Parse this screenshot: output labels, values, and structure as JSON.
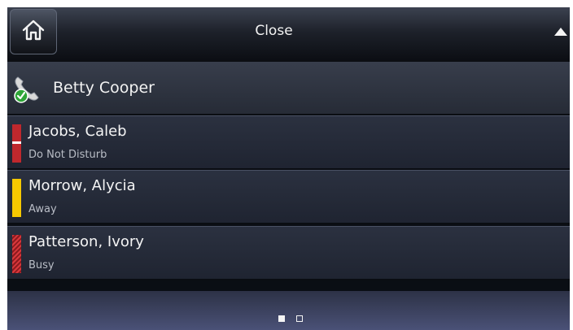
{
  "header": {
    "title": "Close",
    "home_icon": "home-icon",
    "arrow_icon": "triangle-up-icon"
  },
  "line": {
    "name": "Betty Cooper",
    "icon": "phone-handset-registered-icon",
    "registered_color": "#2fa638"
  },
  "contacts": [
    {
      "name": "Jacobs, Caleb",
      "status": "Do Not Disturb",
      "status_color": "#c0282d"
    },
    {
      "name": "Morrow, Alycia",
      "status": "Away",
      "status_color": "#f6c800"
    },
    {
      "name": "Patterson, Ivory",
      "status": "Busy",
      "status_color": "#d8383c"
    }
  ],
  "pagination": {
    "total": 2,
    "current": 1
  }
}
